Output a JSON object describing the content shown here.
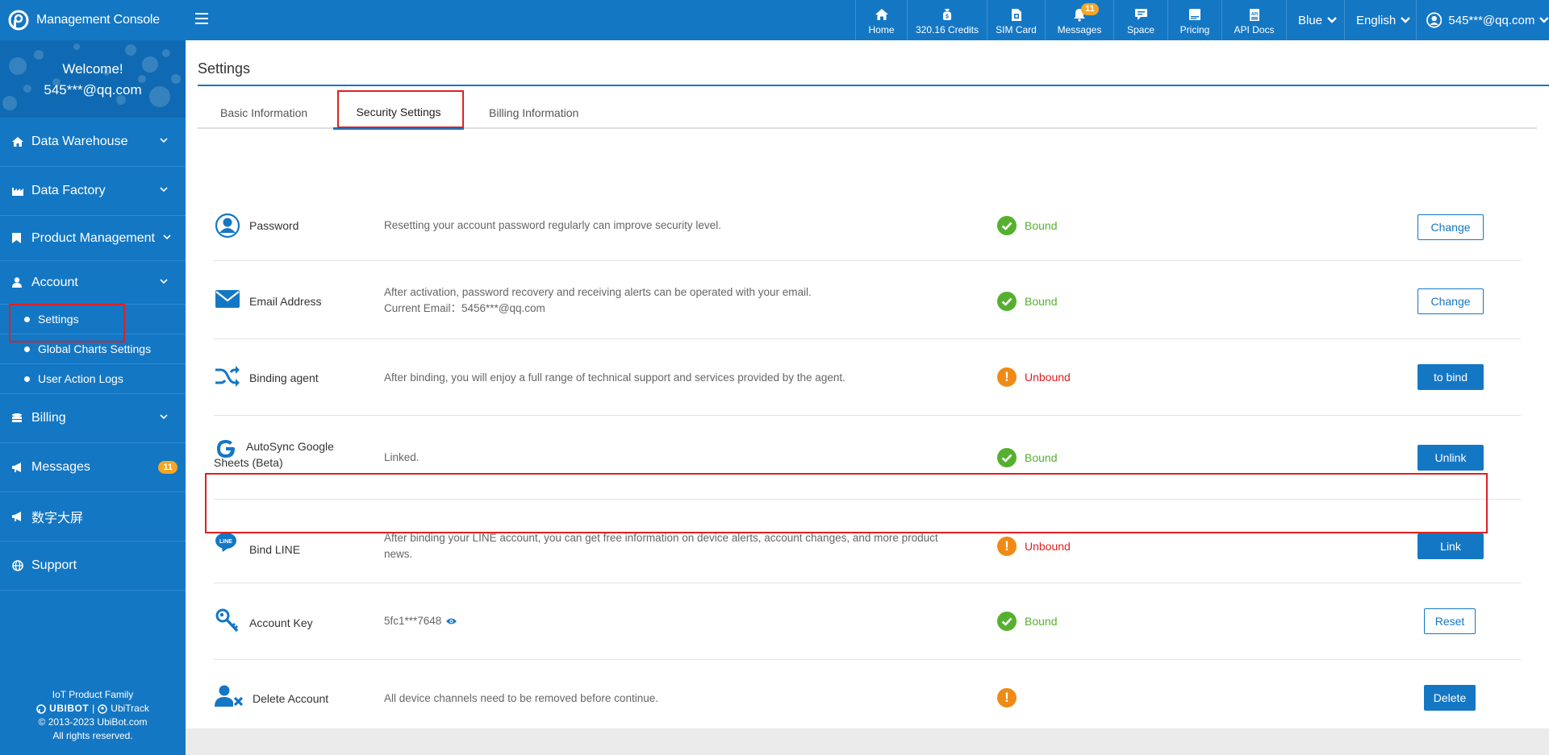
{
  "header": {
    "brand": "Management Console",
    "nav": [
      {
        "label": "Home",
        "icon": "home-icon"
      },
      {
        "label": "320.16 Credits",
        "icon": "credits-icon"
      },
      {
        "label": "SIM Card",
        "icon": "sim-card-icon"
      },
      {
        "label": "Messages",
        "icon": "bell-icon",
        "badge": "11"
      },
      {
        "label": "Space",
        "icon": "chat-icon"
      },
      {
        "label": "Pricing",
        "icon": "pricing-icon"
      },
      {
        "label": "API Docs",
        "icon": "api-icon"
      }
    ],
    "theme": "Blue",
    "language": "English",
    "user": "545***@qq.com"
  },
  "sidebar": {
    "welcome": "Welcome!",
    "user": "545***@qq.com",
    "items": [
      {
        "label": "Data Warehouse"
      },
      {
        "label": "Data Factory"
      },
      {
        "label": "Product Management"
      },
      {
        "label": "Account"
      },
      {
        "label": "Billing"
      },
      {
        "label": "Messages",
        "badge": "11"
      },
      {
        "label": "数字大屏"
      },
      {
        "label": "Support"
      }
    ],
    "subitems": [
      {
        "label": "Settings"
      },
      {
        "label": "Global Charts Settings"
      },
      {
        "label": "User Action Logs"
      }
    ],
    "footer": {
      "line1": "IoT Product Family",
      "brand1": "UBIBOT",
      "sep": "|",
      "brand2": "UbiTrack",
      "copyright": "© 2013-2023 UbiBot.com",
      "rights": "All rights reserved."
    }
  },
  "main": {
    "title": "Settings",
    "tabs": [
      {
        "label": "Basic Information"
      },
      {
        "label": "Security Settings",
        "active": true
      },
      {
        "label": "Billing Information"
      }
    ],
    "rows": [
      {
        "name": "Password",
        "desc1": "Resetting your account password regularly can improve security level.",
        "desc2": "",
        "status": "Bound",
        "button": "Change"
      },
      {
        "name": "Email Address",
        "desc1": "After activation, password recovery and receiving alerts can be operated with your email.",
        "desc2": "Current Email：5456***@qq.com",
        "status": "Bound",
        "button": "Change"
      },
      {
        "name": "Binding agent",
        "desc1": "After binding, you will enjoy a full range of technical support and services provided by the agent.",
        "desc2": "",
        "status": "Unbound",
        "button": "to bind"
      },
      {
        "name1": "AutoSync Google",
        "name2": "Sheets (Beta)",
        "desc1": "Linked.",
        "desc2": "",
        "status": "Bound",
        "button": "Unlink"
      },
      {
        "name": "Bind LINE",
        "desc1": "After binding your LINE account, you can get free information on device alerts, account changes, and more product",
        "desc2": "news.",
        "status": "Unbound",
        "button": "Link"
      },
      {
        "name": "Account Key",
        "desc1": "5fc1***7648",
        "desc2": "",
        "status": "Bound",
        "button": "Reset"
      },
      {
        "name": "Delete Account",
        "desc1": "All device channels need to be removed before continue.",
        "desc2": "",
        "status": "",
        "button": "Delete"
      }
    ]
  },
  "colors": {
    "primary": "#1477c4",
    "ok": "#56b030",
    "warn": "#f08a16",
    "danger": "#e02020",
    "badge": "#f5a623"
  }
}
